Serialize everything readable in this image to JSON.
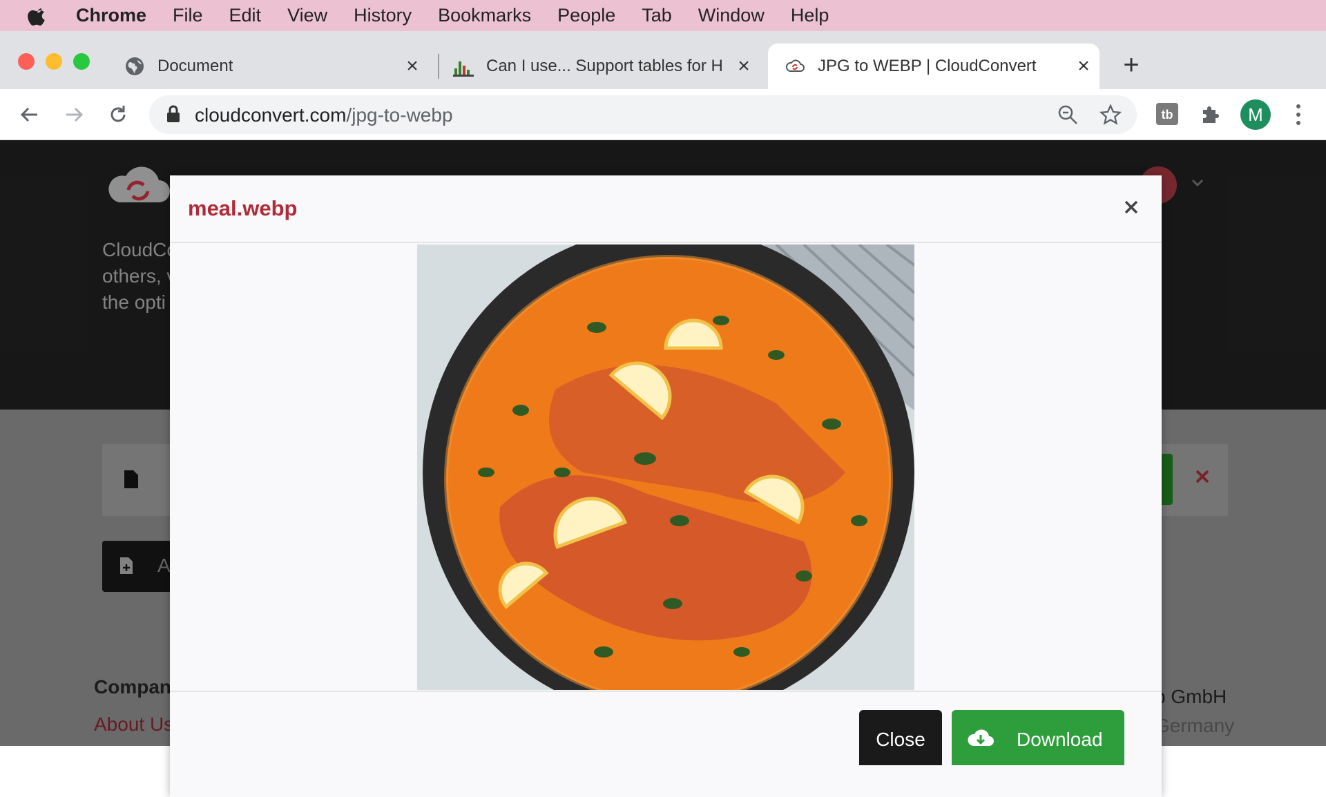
{
  "menubar": {
    "items": [
      {
        "label": "Chrome",
        "bold": true
      },
      {
        "label": "File"
      },
      {
        "label": "Edit"
      },
      {
        "label": "View"
      },
      {
        "label": "History"
      },
      {
        "label": "Bookmarks"
      },
      {
        "label": "People"
      },
      {
        "label": "Tab"
      },
      {
        "label": "Window"
      },
      {
        "label": "Help"
      }
    ]
  },
  "tabs": [
    {
      "title": "Document",
      "icon": "globe-icon",
      "active": false
    },
    {
      "title": "Can I use... Support tables for H",
      "icon": "caniuse-icon",
      "active": false
    },
    {
      "title": "JPG to WEBP | CloudConvert",
      "icon": "cloudconvert-icon",
      "active": true
    }
  ],
  "toolbar": {
    "url_host": "cloudconvert.com",
    "url_path": "/jpg-to-webp",
    "profile_initial": "M"
  },
  "background_page": {
    "text_line1": "CloudCo",
    "text_line2": "others, v",
    "text_line3": "the opti",
    "footer_heading": "Compan",
    "footer_link": "About Us",
    "footer_right1": "b GmbH",
    "footer_right2": "Germany"
  },
  "modal": {
    "title": "meal.webp",
    "close_label": "Close",
    "download_label": "Download"
  },
  "colors": {
    "menubar": "#ecc2d2",
    "accent_title": "#b02a37",
    "download": "#2e9e3c",
    "profile": "#1e8e5e"
  }
}
